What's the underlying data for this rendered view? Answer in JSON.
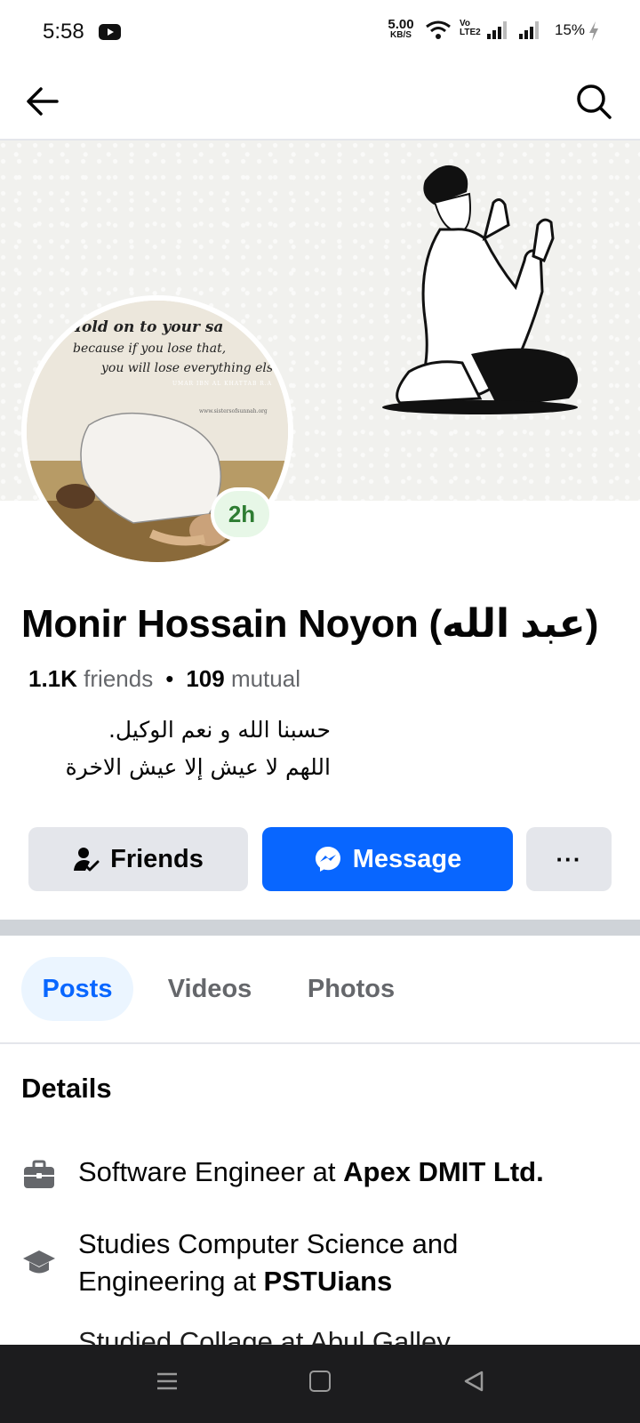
{
  "status_bar": {
    "time": "5:58",
    "net_speed_value": "5.00",
    "net_speed_unit": "KB/S",
    "volte_top": "Vo",
    "volte_bottom": "LTE2",
    "battery": "15%",
    "icons": [
      "youtube-icon",
      "wifi-icon",
      "signal-icon",
      "battery-charging-icon"
    ]
  },
  "top_bar": {
    "icons": [
      "back-arrow-icon",
      "search-icon"
    ]
  },
  "cover": {
    "icon": "praying-man-illustration"
  },
  "avatar": {
    "overlay_line1": "Hold on to your sa",
    "overlay_line2": "because if you lose that,",
    "overlay_line3": "you will lose everything else.",
    "overlay_line4": "UMAR IBN AL KHATTAB R.A",
    "overlay_url": "www.sistersofsunnah.org",
    "badge": "2h"
  },
  "profile": {
    "name": "Monir Hossain Noyon (عبد الله)",
    "friends_count": "1.1K",
    "friends_label": "friends",
    "separator": "•",
    "mutual_count": "109",
    "mutual_label": "mutual",
    "bio_line1": "حسبنا الله و نعم الوكيل.",
    "bio_line2": "اللهم لا عيش إلا عيش الاخرة"
  },
  "actions": {
    "friends_label": "Friends",
    "message_label": "Message",
    "more_label": "···",
    "message_color": "#0866ff"
  },
  "tabs": [
    {
      "label": "Posts",
      "active": true
    },
    {
      "label": "Videos",
      "active": false
    },
    {
      "label": "Photos",
      "active": false
    }
  ],
  "details": {
    "title": "Details",
    "work_prefix": "Software Engineer at ",
    "work_place": "Apex DMIT Ltd.",
    "study_prefix": "Studies Computer Science and Engineering at ",
    "study_place": "PSTUians",
    "studied_partial": "Studied Collage at Abul Galley..."
  },
  "nav_bar": {
    "icons": [
      "menu-icon",
      "home-icon",
      "back-icon"
    ]
  }
}
